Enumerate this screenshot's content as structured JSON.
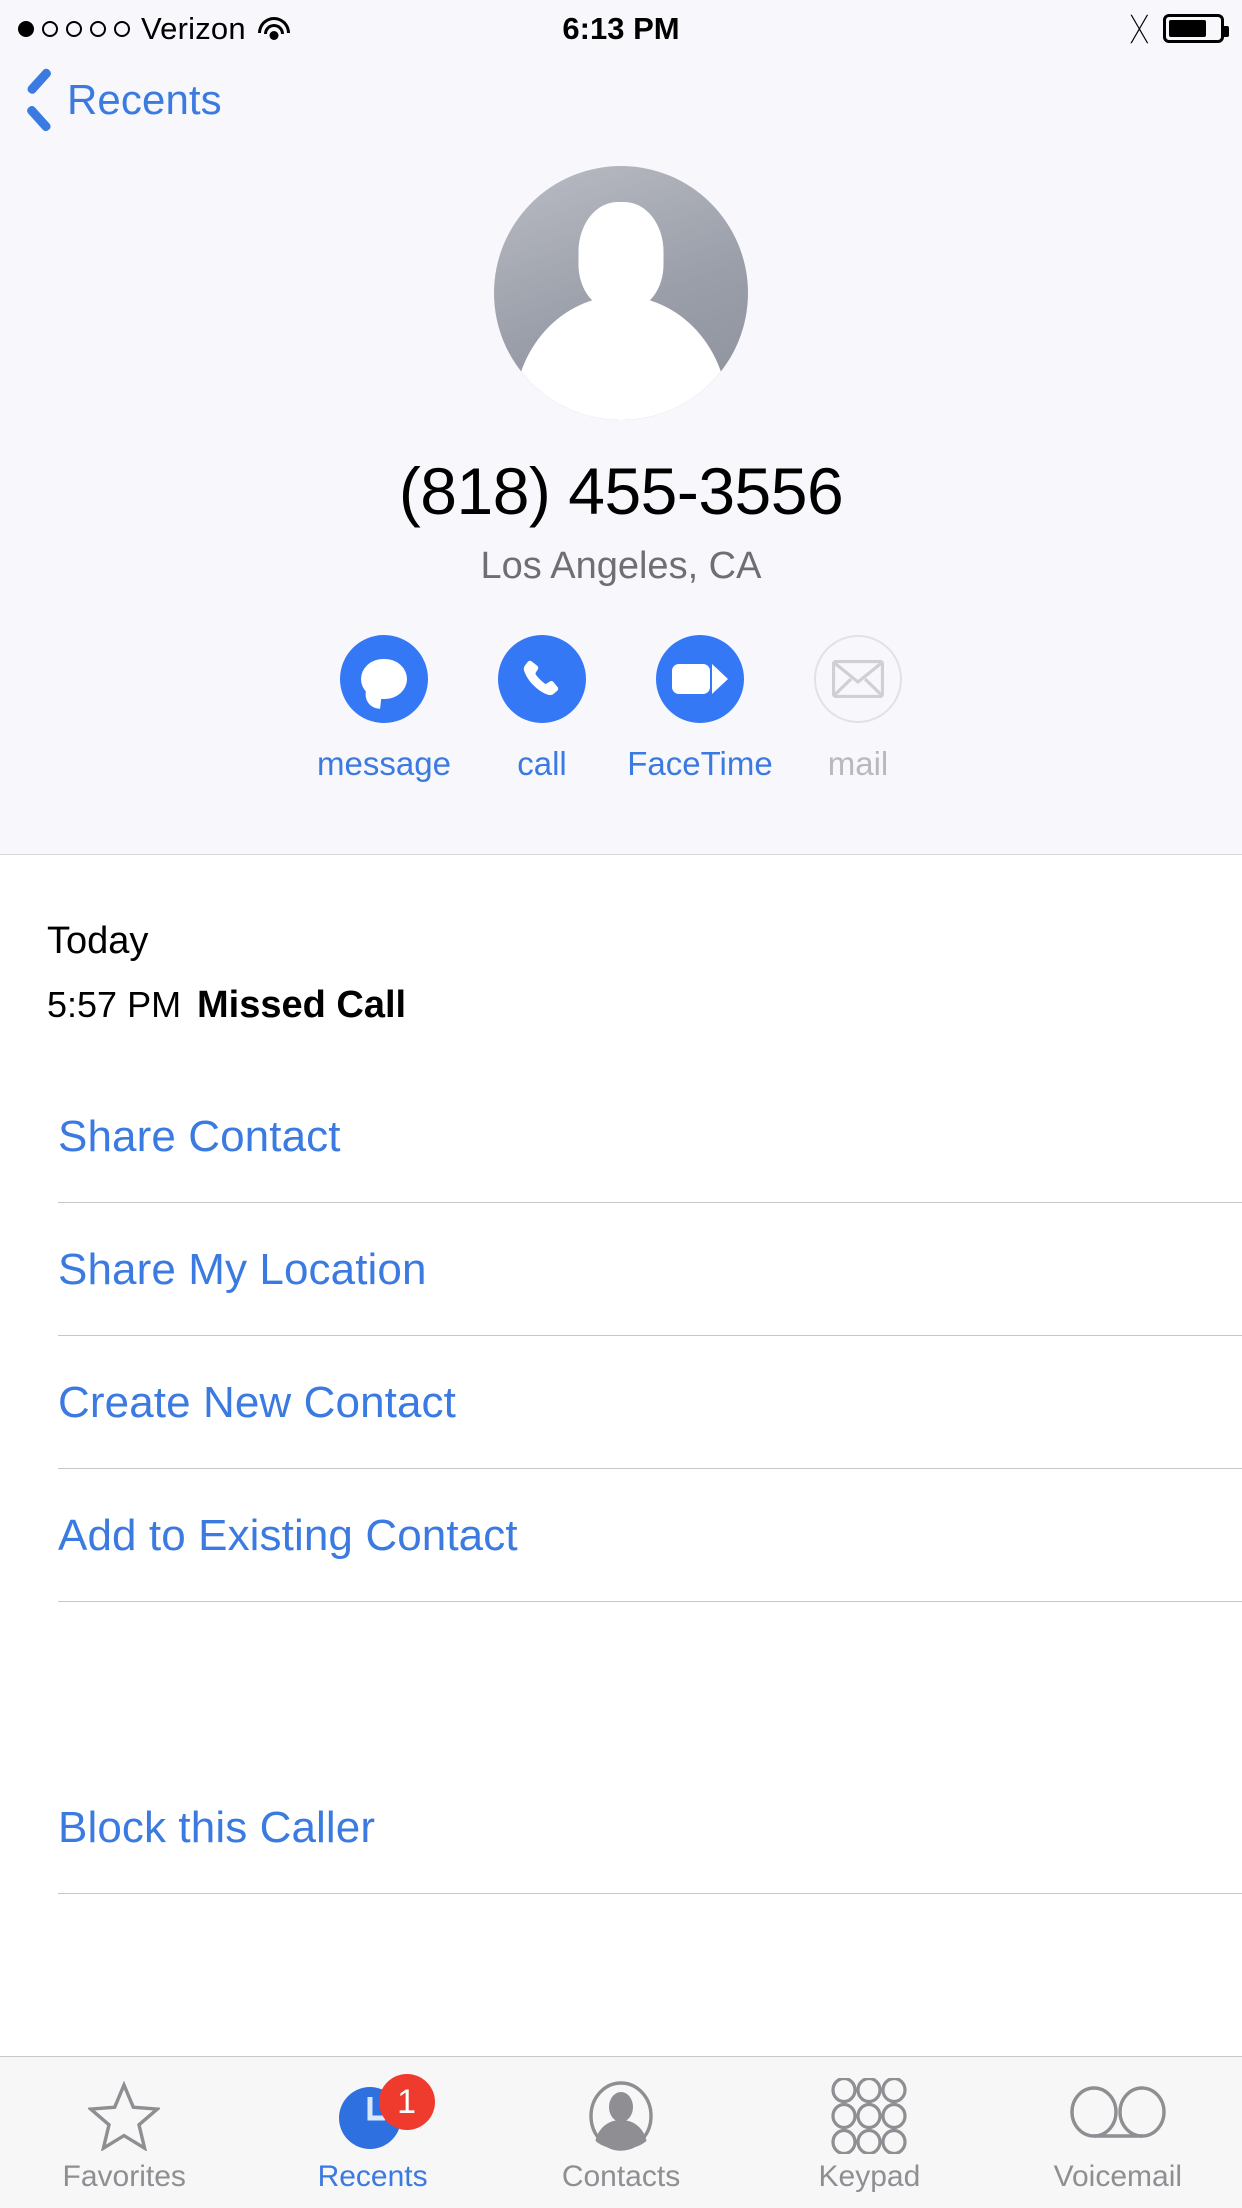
{
  "status_bar": {
    "signal_dots_total": 5,
    "signal_dots_filled": 1,
    "carrier": "Verizon",
    "wifi_icon": "wifi-icon",
    "time": "6:13 PM",
    "bluetooth_icon": "bluetooth-icon",
    "battery_icon": "battery-icon",
    "battery_level_percent": 68
  },
  "nav": {
    "back_label": "Recents",
    "back_icon": "chevron-left-icon"
  },
  "contact": {
    "avatar_icon": "person-placeholder-avatar",
    "phone_number": "(818) 455-3556",
    "location": "Los Angeles, CA",
    "actions": [
      {
        "icon": "message-bubble-icon",
        "label": "message",
        "enabled": true
      },
      {
        "icon": "phone-handset-icon",
        "label": "call",
        "enabled": true
      },
      {
        "icon": "video-camera-icon",
        "label": "FaceTime",
        "enabled": true
      },
      {
        "icon": "envelope-icon",
        "label": "mail",
        "enabled": false
      }
    ]
  },
  "call_log": {
    "day": "Today",
    "time": "5:57 PM",
    "type": "Missed Call"
  },
  "action_rows": [
    {
      "label": "Share Contact"
    },
    {
      "label": "Share My Location"
    },
    {
      "label": "Create New Contact"
    },
    {
      "label": "Add to Existing Contact"
    },
    {
      "label": "Block this Caller"
    }
  ],
  "tab_bar": {
    "items": [
      {
        "icon": "star-outline-icon",
        "label": "Favorites",
        "active": false,
        "badge": null
      },
      {
        "icon": "clock-filled-icon",
        "label": "Recents",
        "active": true,
        "badge": "1"
      },
      {
        "icon": "contacts-person-circle-icon",
        "label": "Contacts",
        "active": false,
        "badge": null
      },
      {
        "icon": "keypad-dots-icon",
        "label": "Keypad",
        "active": false,
        "badge": null
      },
      {
        "icon": "voicemail-icon",
        "label": "Voicemail",
        "active": false,
        "badge": null
      }
    ]
  },
  "colors": {
    "accent_blue": "#3478f6",
    "link_blue": "#3b7ae0",
    "badge_red": "#ef3b2d",
    "header_bg": "#f7f7fc",
    "inactive_gray": "#8e8e93"
  }
}
